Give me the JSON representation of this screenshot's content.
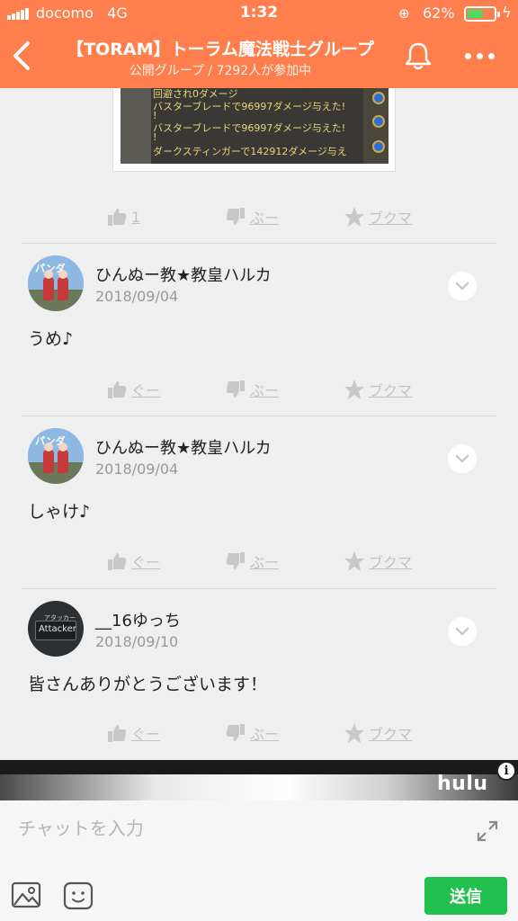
{
  "status": {
    "carrier": "docomo",
    "network": "4G",
    "time": "1:32",
    "battery": "62%",
    "battery_level": 0.62
  },
  "header": {
    "title": "【TORAM】トーラム魔法戦士グループ",
    "subtitle": "公開グループ / 7292人が参加中"
  },
  "preview": {
    "lines": [
      "回避され0ダメージ",
      "バスターブレードで96997ダメージ与えた!",
      "!",
      "バスターブレードで96997ダメージ与えた!",
      "!",
      "ダークスティンガーで142912ダメージ与え"
    ]
  },
  "post_actions": {
    "like": "1",
    "dislike": "ぶー",
    "bookmark": "ブクマ"
  },
  "comments": [
    {
      "user": "ひんぬー教★教皇ハルカ",
      "date": "2018/09/04",
      "text": "うめ♪",
      "avatar_tag": "パンダ",
      "actions": {
        "like": "ぐー",
        "dislike": "ぶー",
        "bookmark": "ブクマ"
      }
    },
    {
      "user": "ひんぬー教★教皇ハルカ",
      "date": "2018/09/04",
      "text": "しゃけ♪",
      "avatar_tag": "パンダ",
      "actions": {
        "like": "ぐー",
        "dislike": "ぶー",
        "bookmark": "ブクマ"
      }
    },
    {
      "user": "__16ゆっち",
      "date": "2018/09/10",
      "text": "皆さんありがとうございます！",
      "avatar_tag": "Attacker",
      "avatar_sub": "アタッカー",
      "actions": {
        "like": "ぐー",
        "dislike": "ぶー",
        "bookmark": "ブクマ"
      }
    }
  ],
  "ad": {
    "brand": "hulu",
    "info": "i"
  },
  "chat": {
    "placeholder": "チャットを入力",
    "send_label": "送信"
  },
  "colors": {
    "header": "#ff7e4d",
    "send": "#22c04e",
    "action": "#c2c2c2",
    "battery_fill": "#4cd964"
  }
}
